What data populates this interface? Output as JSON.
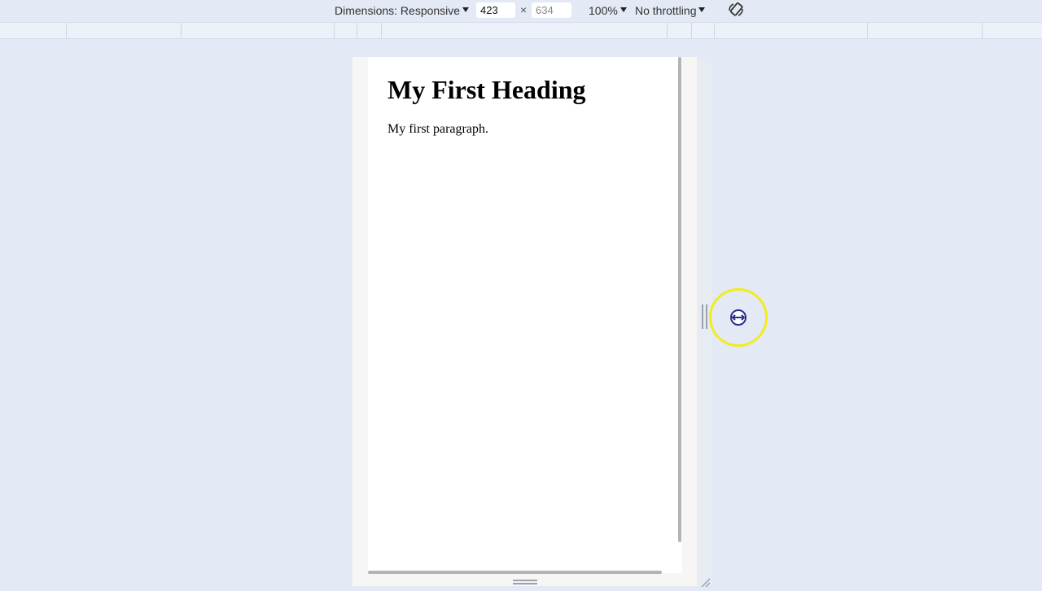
{
  "toolbar": {
    "dimensions_label": "Dimensions: Responsive",
    "width_value": "423",
    "height_placeholder": "634",
    "times_symbol": "×",
    "zoom_label": "100%",
    "throttling_label": "No throttling",
    "rotate_icon": "rotate-icon"
  },
  "viewport": {
    "heading": "My First Heading",
    "paragraph": "My first paragraph."
  },
  "colors": {
    "background": "#e3e9f5",
    "cursor_highlight": "#f2ec1c",
    "scrollbar": "#b3b3b3"
  },
  "icons": {
    "resize_cursor": "horizontal-resize-cursor-icon",
    "resize_corner": "resize-corner-icon"
  }
}
